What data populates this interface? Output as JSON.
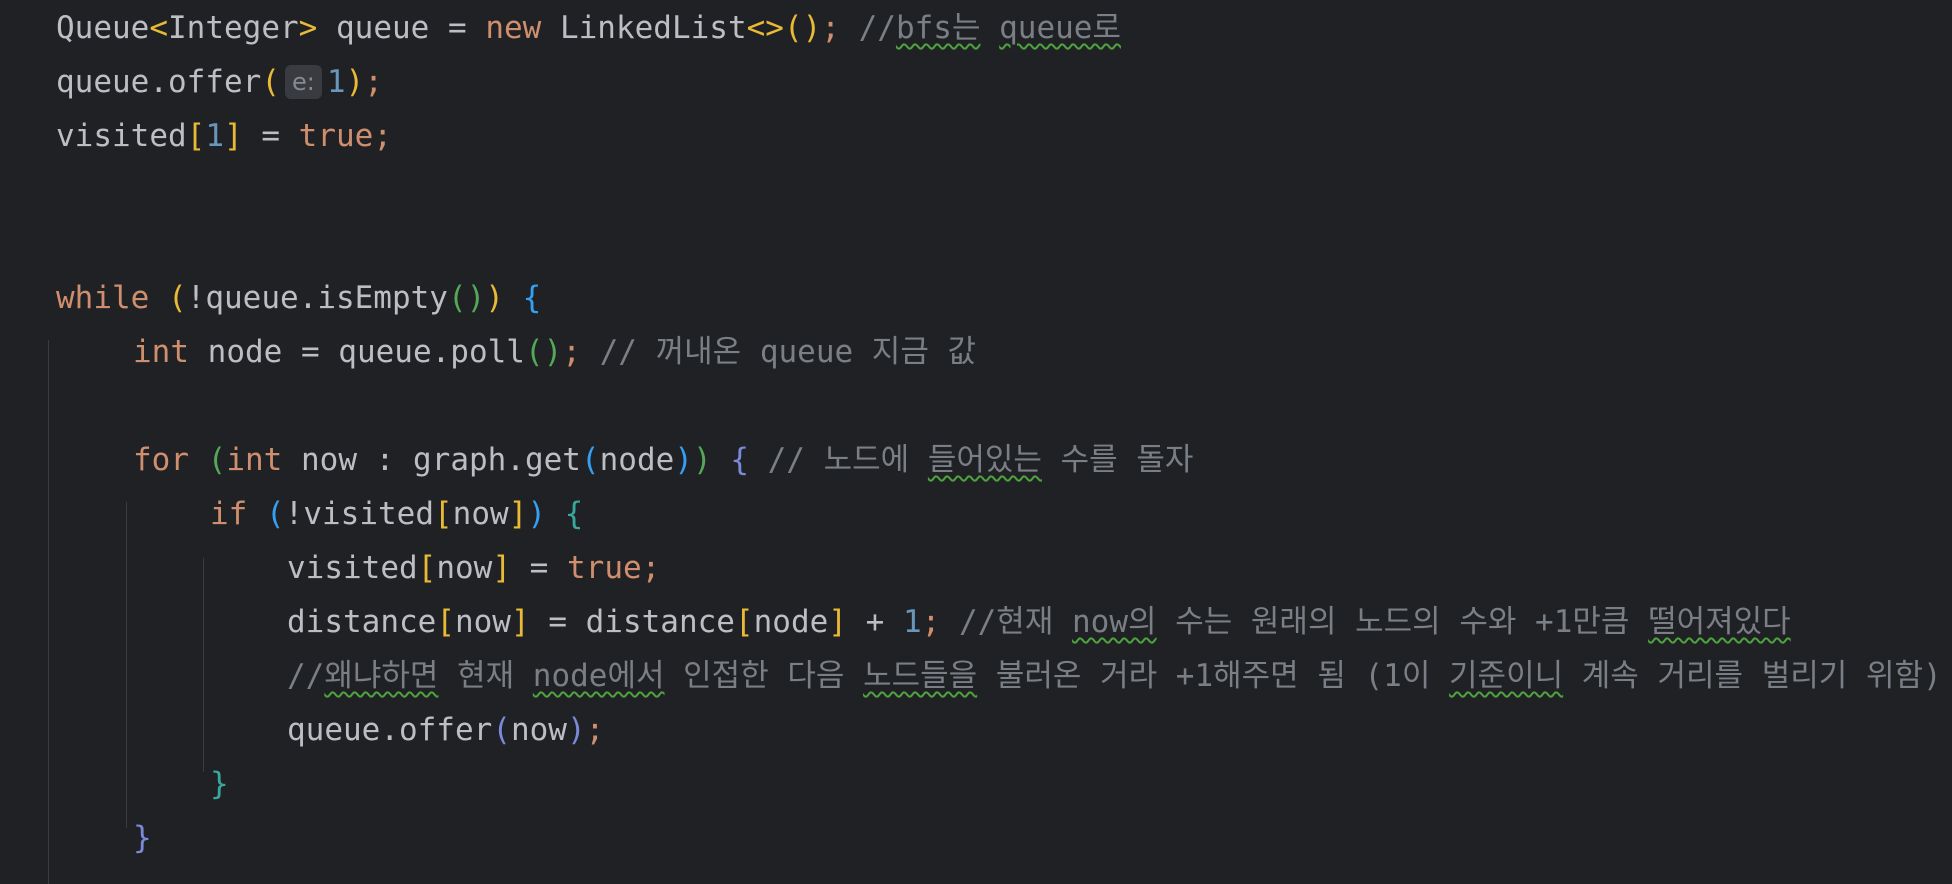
{
  "editor": {
    "language": "Java",
    "colors": {
      "background": "#1f2124",
      "keyword": "#cf8e6d",
      "text": "#bcbec4",
      "comment": "#7a7e85",
      "number": "#6897bb",
      "bracket_level1": "#e8ba36",
      "bracket_level2": "#54a857",
      "bracket_level3": "#359ff4",
      "bracket_level4": "#7a89d8",
      "bracket_level5": "#38a89d",
      "typo_underline": "#4fa33e",
      "inlay_hint_bg": "#393b40"
    },
    "lines": [
      {
        "indent": 0,
        "tokens": [
          {
            "t": "Queue",
            "c": "tx"
          },
          {
            "t": "<",
            "c": "p1"
          },
          {
            "t": "Integer",
            "c": "tx"
          },
          {
            "t": ">",
            "c": "p1"
          },
          {
            "t": " queue = ",
            "c": "tx"
          },
          {
            "t": "new",
            "c": "kw"
          },
          {
            "t": " LinkedList",
            "c": "tx"
          },
          {
            "t": "<>()",
            "c": "p1"
          },
          {
            "t": ";",
            "c": "kw"
          },
          {
            "t": " //",
            "c": "cm"
          },
          {
            "t": "bfs는",
            "c": "cm",
            "typo": true
          },
          {
            "t": " ",
            "c": "cm"
          },
          {
            "t": "queue로",
            "c": "cm",
            "typo": true
          }
        ]
      },
      {
        "indent": 0,
        "tokens": [
          {
            "t": "queue.offer",
            "c": "tx"
          },
          {
            "t": "(",
            "c": "p1"
          },
          {
            "t": "e:",
            "c": "hint"
          },
          {
            "t": "1",
            "c": "num"
          },
          {
            "t": ")",
            "c": "p1"
          },
          {
            "t": ";",
            "c": "kw"
          }
        ]
      },
      {
        "indent": 0,
        "tokens": [
          {
            "t": "visited",
            "c": "tx"
          },
          {
            "t": "[",
            "c": "p1"
          },
          {
            "t": "1",
            "c": "num"
          },
          {
            "t": "]",
            "c": "p1"
          },
          {
            "t": " = ",
            "c": "tx"
          },
          {
            "t": "true",
            "c": "kw"
          },
          {
            "t": ";",
            "c": "kw"
          }
        ]
      },
      {
        "indent": 0,
        "tokens": []
      },
      {
        "indent": 0,
        "tokens": []
      },
      {
        "indent": 0,
        "tokens": [
          {
            "t": "while",
            "c": "kw"
          },
          {
            "t": " ",
            "c": "tx"
          },
          {
            "t": "(",
            "c": "p1"
          },
          {
            "t": "!queue.isEmpty",
            "c": "tx"
          },
          {
            "t": "()",
            "c": "p2"
          },
          {
            "t": ")",
            "c": "p1"
          },
          {
            "t": " ",
            "c": "tx"
          },
          {
            "t": "{",
            "c": "p3"
          }
        ]
      },
      {
        "indent": 1,
        "tokens": [
          {
            "t": "int",
            "c": "kw"
          },
          {
            "t": " node = queue.poll",
            "c": "tx"
          },
          {
            "t": "()",
            "c": "p2"
          },
          {
            "t": ";",
            "c": "kw"
          },
          {
            "t": " // 꺼내온 queue 지금 값",
            "c": "cm"
          }
        ]
      },
      {
        "indent": 1,
        "tokens": []
      },
      {
        "indent": 1,
        "tokens": [
          {
            "t": "for",
            "c": "kw"
          },
          {
            "t": " ",
            "c": "tx"
          },
          {
            "t": "(",
            "c": "p2"
          },
          {
            "t": "int",
            "c": "kw"
          },
          {
            "t": " now : graph.get",
            "c": "tx"
          },
          {
            "t": "(",
            "c": "p3"
          },
          {
            "t": "node",
            "c": "tx"
          },
          {
            "t": ")",
            "c": "p3"
          },
          {
            "t": ")",
            "c": "p2"
          },
          {
            "t": " ",
            "c": "tx"
          },
          {
            "t": "{",
            "c": "p4"
          },
          {
            "t": " // 노드에 ",
            "c": "cm"
          },
          {
            "t": "들어있는",
            "c": "cm",
            "typo": true
          },
          {
            "t": " 수를 돌자",
            "c": "cm"
          }
        ]
      },
      {
        "indent": 2,
        "tokens": [
          {
            "t": "if",
            "c": "kw"
          },
          {
            "t": " ",
            "c": "tx"
          },
          {
            "t": "(",
            "c": "p3"
          },
          {
            "t": "!visited",
            "c": "tx"
          },
          {
            "t": "[",
            "c": "p1"
          },
          {
            "t": "now",
            "c": "tx"
          },
          {
            "t": "]",
            "c": "p1"
          },
          {
            "t": ")",
            "c": "p3"
          },
          {
            "t": " ",
            "c": "tx"
          },
          {
            "t": "{",
            "c": "p5"
          }
        ]
      },
      {
        "indent": 3,
        "tokens": [
          {
            "t": "visited",
            "c": "tx"
          },
          {
            "t": "[",
            "c": "p1"
          },
          {
            "t": "now",
            "c": "tx"
          },
          {
            "t": "]",
            "c": "p1"
          },
          {
            "t": " = ",
            "c": "tx"
          },
          {
            "t": "true",
            "c": "kw"
          },
          {
            "t": ";",
            "c": "kw"
          }
        ]
      },
      {
        "indent": 3,
        "tokens": [
          {
            "t": "distance",
            "c": "tx"
          },
          {
            "t": "[",
            "c": "p1"
          },
          {
            "t": "now",
            "c": "tx"
          },
          {
            "t": "]",
            "c": "p1"
          },
          {
            "t": " = distance",
            "c": "tx"
          },
          {
            "t": "[",
            "c": "p1"
          },
          {
            "t": "node",
            "c": "tx"
          },
          {
            "t": "]",
            "c": "p1"
          },
          {
            "t": " + ",
            "c": "tx"
          },
          {
            "t": "1",
            "c": "num"
          },
          {
            "t": ";",
            "c": "kw"
          },
          {
            "t": " //현재 ",
            "c": "cm"
          },
          {
            "t": "now의",
            "c": "cm",
            "typo": true
          },
          {
            "t": " 수는 원래의 노드의 수와 +1만큼 ",
            "c": "cm"
          },
          {
            "t": "떨어져있다",
            "c": "cm",
            "typo": true
          }
        ]
      },
      {
        "indent": 3,
        "tokens": [
          {
            "t": "//",
            "c": "cm"
          },
          {
            "t": "왜냐하면",
            "c": "cm",
            "typo": true
          },
          {
            "t": " 현재 ",
            "c": "cm"
          },
          {
            "t": "node에서",
            "c": "cm",
            "typo": true
          },
          {
            "t": " 인접한 다음 ",
            "c": "cm"
          },
          {
            "t": "노드들을",
            "c": "cm",
            "typo": true
          },
          {
            "t": " 불러온 거라 +1해주면 됨 (1이 ",
            "c": "cm"
          },
          {
            "t": "기준이니",
            "c": "cm",
            "typo": true
          },
          {
            "t": " 계속 거리를 벌리기 위함)",
            "c": "cm"
          }
        ]
      },
      {
        "indent": 3,
        "tokens": [
          {
            "t": "queue.offer",
            "c": "tx"
          },
          {
            "t": "(",
            "c": "p4"
          },
          {
            "t": "now",
            "c": "tx"
          },
          {
            "t": ")",
            "c": "p4"
          },
          {
            "t": ";",
            "c": "kw"
          }
        ]
      },
      {
        "indent": 2,
        "tokens": [
          {
            "t": "}",
            "c": "p5"
          }
        ]
      },
      {
        "indent": 1,
        "tokens": [
          {
            "t": "}",
            "c": "p4"
          }
        ]
      }
    ]
  }
}
